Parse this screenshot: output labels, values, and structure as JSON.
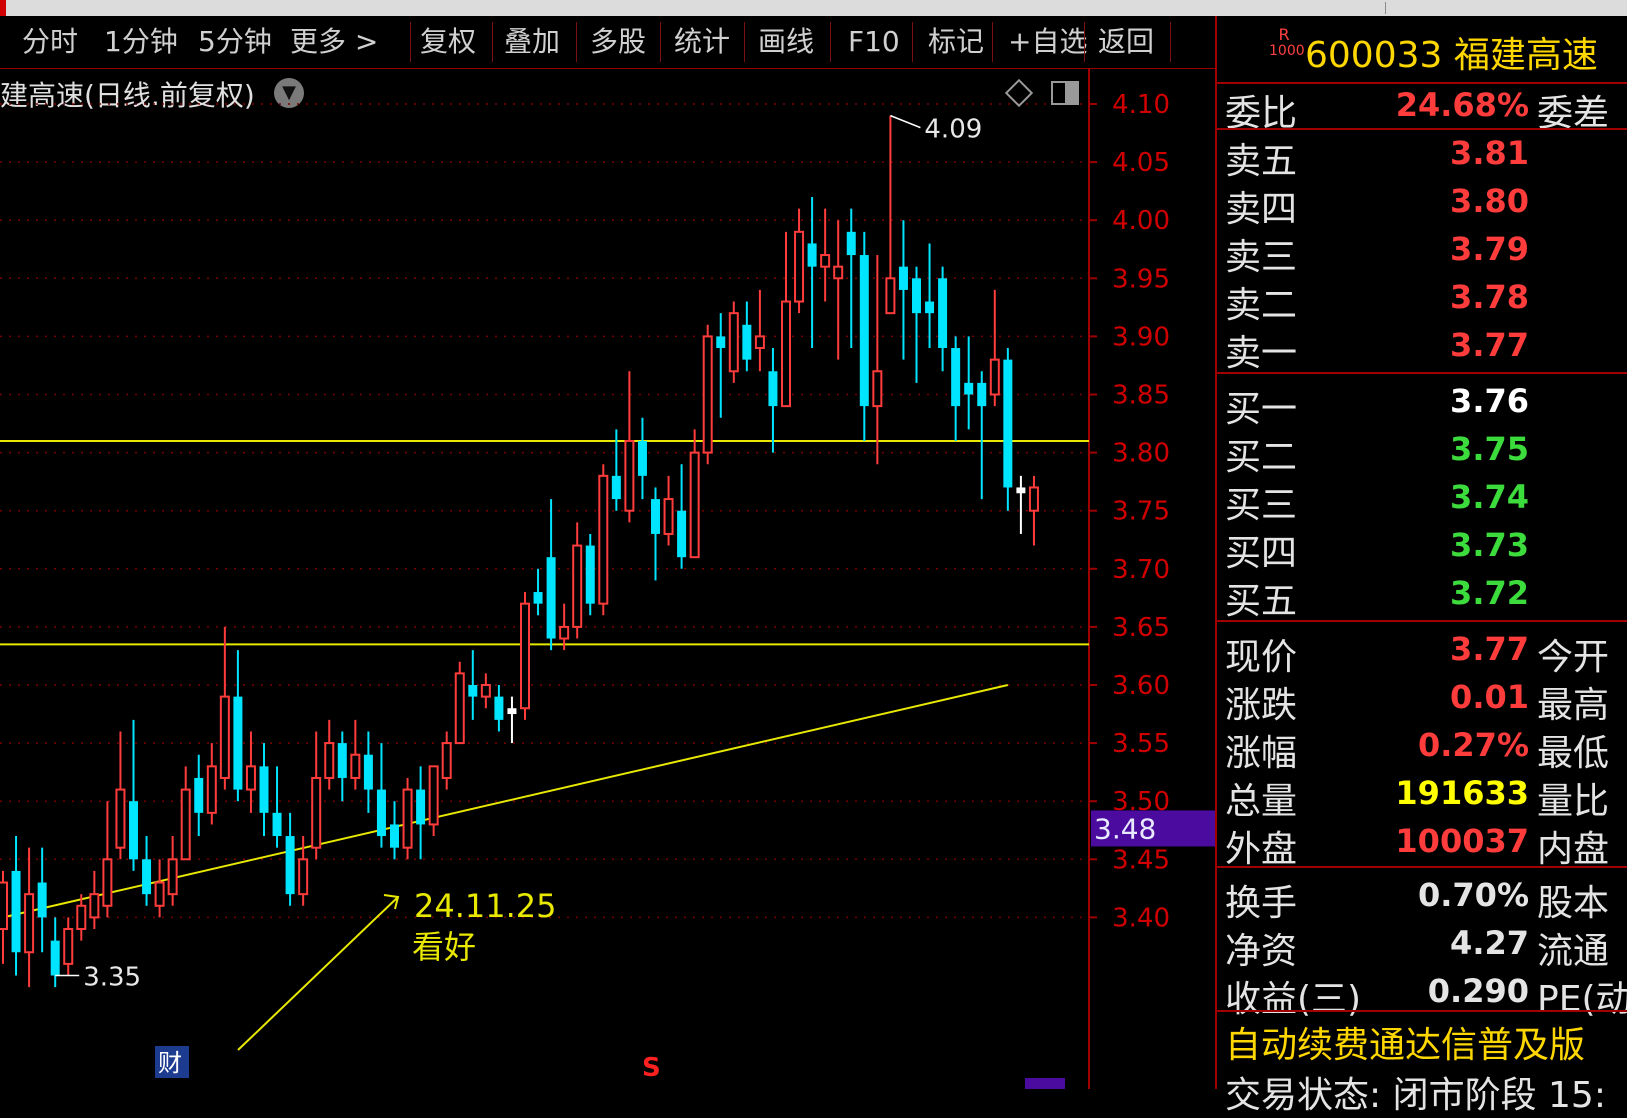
{
  "toolbar": {
    "items": [
      "分时",
      "1分钟",
      "5分钟",
      "更多 >",
      "复权",
      "叠加",
      "多股",
      "统计",
      "画线",
      "F10",
      "标记",
      "+自选",
      "返回"
    ]
  },
  "chart": {
    "title": "建高速(日线.前复权)",
    "price_axis": [
      "4.10",
      "4.05",
      "4.00",
      "3.95",
      "3.90",
      "3.85",
      "3.80",
      "3.75",
      "3.70",
      "3.65",
      "3.60",
      "3.55",
      "3.50",
      "3.45",
      "3.40"
    ],
    "current_price_tag": "3.48",
    "high_marker": "4.09",
    "low_marker": "3.35",
    "annotation_date": "24.11.25",
    "annotation_text": "看好",
    "badge_cai": "财",
    "badge_s": "S",
    "colors": {
      "up": "#ff3c3c",
      "down": "#00e5ff",
      "doji": "#ffffff",
      "trend": "#e8e800",
      "grid": "#7a0000"
    }
  },
  "chart_data": {
    "type": "candlestick",
    "ylim": [
      3.32,
      4.12
    ],
    "horizontal_lines": [
      3.81,
      3.635
    ],
    "trendline": [
      [
        0,
        3.4
      ],
      [
        77,
        3.6
      ]
    ],
    "candles": [
      [
        3.39,
        3.43,
        3.44,
        3.36
      ],
      [
        3.44,
        3.37,
        3.47,
        3.35
      ],
      [
        3.37,
        3.42,
        3.46,
        3.34
      ],
      [
        3.43,
        3.4,
        3.46,
        3.37
      ],
      [
        3.38,
        3.35,
        3.4,
        3.34
      ],
      [
        3.36,
        3.39,
        3.4,
        3.35
      ],
      [
        3.39,
        3.41,
        3.42,
        3.38
      ],
      [
        3.4,
        3.42,
        3.44,
        3.39
      ],
      [
        3.41,
        3.45,
        3.5,
        3.4
      ],
      [
        3.46,
        3.51,
        3.56,
        3.45
      ],
      [
        3.5,
        3.45,
        3.57,
        3.44
      ],
      [
        3.45,
        3.42,
        3.47,
        3.41
      ],
      [
        3.41,
        3.43,
        3.45,
        3.4
      ],
      [
        3.42,
        3.45,
        3.47,
        3.41
      ],
      [
        3.45,
        3.51,
        3.53,
        3.45
      ],
      [
        3.52,
        3.49,
        3.54,
        3.47
      ],
      [
        3.49,
        3.53,
        3.55,
        3.48
      ],
      [
        3.52,
        3.59,
        3.65,
        3.51
      ],
      [
        3.59,
        3.51,
        3.63,
        3.5
      ],
      [
        3.51,
        3.53,
        3.56,
        3.49
      ],
      [
        3.53,
        3.49,
        3.55,
        3.47
      ],
      [
        3.49,
        3.47,
        3.53,
        3.46
      ],
      [
        3.47,
        3.42,
        3.49,
        3.41
      ],
      [
        3.42,
        3.45,
        3.47,
        3.41
      ],
      [
        3.46,
        3.52,
        3.56,
        3.45
      ],
      [
        3.52,
        3.55,
        3.57,
        3.51
      ],
      [
        3.55,
        3.52,
        3.56,
        3.5
      ],
      [
        3.52,
        3.54,
        3.57,
        3.51
      ],
      [
        3.54,
        3.51,
        3.56,
        3.49
      ],
      [
        3.51,
        3.47,
        3.55,
        3.46
      ],
      [
        3.48,
        3.46,
        3.5,
        3.45
      ],
      [
        3.46,
        3.51,
        3.52,
        3.45
      ],
      [
        3.51,
        3.48,
        3.53,
        3.45
      ],
      [
        3.48,
        3.53,
        3.53,
        3.47
      ],
      [
        3.52,
        3.55,
        3.56,
        3.51
      ],
      [
        3.55,
        3.61,
        3.62,
        3.55
      ],
      [
        3.6,
        3.59,
        3.63,
        3.57
      ],
      [
        3.59,
        3.6,
        3.61,
        3.58
      ],
      [
        3.59,
        3.57,
        3.6,
        3.56
      ],
      [
        3.58,
        3.575,
        3.59,
        3.55
      ],
      [
        3.58,
        3.67,
        3.68,
        3.57
      ],
      [
        3.68,
        3.67,
        3.7,
        3.66
      ],
      [
        3.71,
        3.64,
        3.76,
        3.63
      ],
      [
        3.64,
        3.65,
        3.67,
        3.63
      ],
      [
        3.65,
        3.72,
        3.74,
        3.64
      ],
      [
        3.72,
        3.67,
        3.73,
        3.66
      ],
      [
        3.67,
        3.78,
        3.79,
        3.66
      ],
      [
        3.78,
        3.76,
        3.82,
        3.75
      ],
      [
        3.75,
        3.81,
        3.87,
        3.74
      ],
      [
        3.81,
        3.78,
        3.83,
        3.76
      ],
      [
        3.76,
        3.73,
        3.77,
        3.69
      ],
      [
        3.73,
        3.76,
        3.78,
        3.72
      ],
      [
        3.75,
        3.71,
        3.79,
        3.7
      ],
      [
        3.71,
        3.8,
        3.82,
        3.71
      ],
      [
        3.8,
        3.9,
        3.91,
        3.79
      ],
      [
        3.9,
        3.89,
        3.92,
        3.83
      ],
      [
        3.87,
        3.92,
        3.93,
        3.86
      ],
      [
        3.91,
        3.88,
        3.93,
        3.87
      ],
      [
        3.89,
        3.9,
        3.94,
        3.87
      ],
      [
        3.87,
        3.84,
        3.89,
        3.8
      ],
      [
        3.84,
        3.93,
        3.99,
        3.84
      ],
      [
        3.93,
        3.99,
        4.01,
        3.92
      ],
      [
        3.98,
        3.96,
        4.02,
        3.89
      ],
      [
        3.96,
        3.97,
        4.01,
        3.93
      ],
      [
        3.95,
        3.96,
        4.0,
        3.88
      ],
      [
        3.99,
        3.97,
        4.01,
        3.89
      ],
      [
        3.97,
        3.84,
        3.99,
        3.81
      ],
      [
        3.84,
        3.87,
        3.97,
        3.79
      ],
      [
        3.92,
        3.95,
        4.09,
        3.93
      ],
      [
        3.96,
        3.94,
        4.0,
        3.88
      ],
      [
        3.95,
        3.92,
        3.96,
        3.86
      ],
      [
        3.93,
        3.92,
        3.98,
        3.89
      ],
      [
        3.95,
        3.89,
        3.96,
        3.87
      ],
      [
        3.89,
        3.84,
        3.9,
        3.81
      ],
      [
        3.86,
        3.85,
        3.9,
        3.82
      ],
      [
        3.86,
        3.84,
        3.87,
        3.76
      ],
      [
        3.85,
        3.88,
        3.94,
        3.84
      ],
      [
        3.88,
        3.77,
        3.89,
        3.75
      ],
      [
        3.77,
        3.765,
        3.78,
        3.73
      ],
      [
        3.75,
        3.77,
        3.78,
        3.72
      ]
    ]
  },
  "panel": {
    "stock_code": "600033",
    "stock_name": "福建高速",
    "logo_top": "R",
    "logo_bottom": "1000",
    "rows": [
      {
        "label": "委比",
        "value": "24.68%",
        "label2": "委差",
        "color": "#ff3c3c"
      },
      {
        "label": "卖五",
        "value": "3.81",
        "label2": "",
        "color": "#ff3c3c"
      },
      {
        "label": "卖四",
        "value": "3.80",
        "label2": "",
        "color": "#ff3c3c"
      },
      {
        "label": "卖三",
        "value": "3.79",
        "label2": "",
        "color": "#ff3c3c"
      },
      {
        "label": "卖二",
        "value": "3.78",
        "label2": "",
        "color": "#ff3c3c"
      },
      {
        "label": "卖一",
        "value": "3.77",
        "label2": "",
        "color": "#ff3c3c"
      },
      {
        "label": "买一",
        "value": "3.76",
        "label2": "",
        "color": "#ffffff"
      },
      {
        "label": "买二",
        "value": "3.75",
        "label2": "",
        "color": "#3cdc3c"
      },
      {
        "label": "买三",
        "value": "3.74",
        "label2": "",
        "color": "#3cdc3c"
      },
      {
        "label": "买四",
        "value": "3.73",
        "label2": "",
        "color": "#3cdc3c"
      },
      {
        "label": "买五",
        "value": "3.72",
        "label2": "",
        "color": "#3cdc3c"
      },
      {
        "label": "现价",
        "value": "3.77",
        "label2": "今开",
        "color": "#ff3c3c"
      },
      {
        "label": "涨跌",
        "value": "0.01",
        "label2": "最高",
        "color": "#ff3c3c"
      },
      {
        "label": "涨幅",
        "value": "0.27%",
        "label2": "最低",
        "color": "#ff3c3c"
      },
      {
        "label": "总量",
        "value": "191633",
        "label2": "量比",
        "color": "#ffff00"
      },
      {
        "label": "外盘",
        "value": "100037",
        "label2": "内盘",
        "color": "#ff3c3c"
      },
      {
        "label": "换手",
        "value": "0.70%",
        "label2": "股本",
        "color": "#e4e4e4"
      },
      {
        "label": "净资",
        "value": "4.27",
        "label2": "流通",
        "color": "#e4e4e4"
      },
      {
        "label": "收益(三)",
        "value": "0.290",
        "label2": "PE(动",
        "color": "#e4e4e4"
      }
    ],
    "ad_text": "自动续费通达信普及版",
    "status_text": "交易状态: 闭市阶段 15:"
  }
}
